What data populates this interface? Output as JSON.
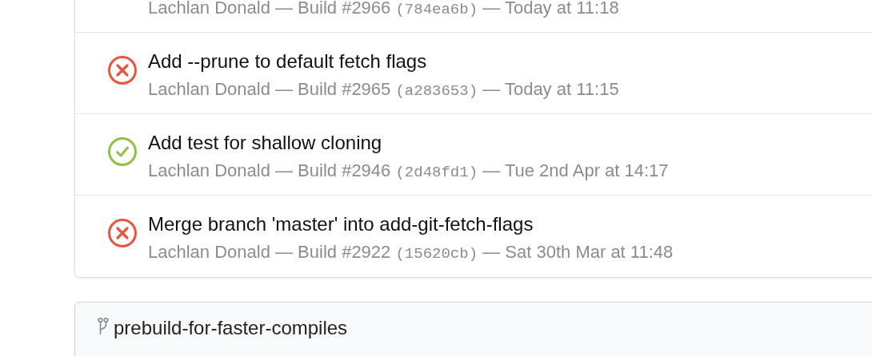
{
  "builds": [
    {
      "byline": "Lachlan Donald — Build #2966",
      "commit": "(784ea6b)",
      "time": "— Today at 11:18"
    },
    {
      "kind": "failed",
      "title": "Add --prune to default fetch flags",
      "byline": "Lachlan Donald — Build #2965",
      "commit": "(a283653)",
      "time": "— Today at 11:15"
    },
    {
      "kind": "passed",
      "title": "Add test for shallow cloning",
      "byline": "Lachlan Donald — Build #2946",
      "commit": "(2d48fd1)",
      "time": "— Tue 2nd Apr at 14:17"
    },
    {
      "kind": "failed",
      "title": "Merge branch 'master' into add-git-fetch-flags",
      "byline": "Lachlan Donald — Build #2922",
      "commit": "(15620cb)",
      "time": "— Sat 30th Mar at 11:48"
    }
  ],
  "next_branch": {
    "name": "prebuild-for-faster-compiles"
  }
}
